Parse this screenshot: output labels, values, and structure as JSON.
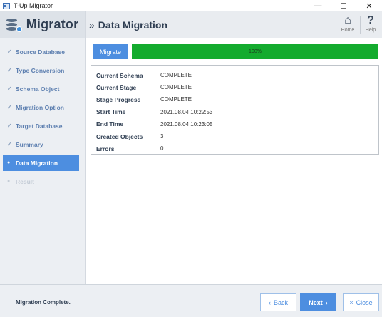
{
  "window": {
    "title": "T-Up Migrator",
    "minimize": "—",
    "maximize": "☐",
    "close": "✕"
  },
  "logo": {
    "text": "Migrator"
  },
  "sidebar": {
    "items": [
      {
        "label": "Source Database",
        "mark": "✓",
        "state": "done"
      },
      {
        "label": "Type Conversion",
        "mark": "✓",
        "state": "done"
      },
      {
        "label": "Schema Object",
        "mark": "✓",
        "state": "done"
      },
      {
        "label": "Migration Option",
        "mark": "✓",
        "state": "done"
      },
      {
        "label": "Target Database",
        "mark": "✓",
        "state": "done"
      },
      {
        "label": "Summary",
        "mark": "✓",
        "state": "done"
      },
      {
        "label": "Data Migration",
        "mark": "●",
        "state": "active"
      },
      {
        "label": "Result",
        "mark": "●",
        "state": "disabled"
      }
    ]
  },
  "header": {
    "arrow": "»",
    "title": "Data Migration",
    "home_label": "Home",
    "home_glyph": "⌂",
    "help_label": "Help",
    "help_glyph": "?"
  },
  "migration": {
    "button_label": "Migrate",
    "progress": 100,
    "progress_text": "100%"
  },
  "info": {
    "rows": [
      {
        "key": "Current Schema",
        "value": "COMPLETE"
      },
      {
        "key": "Current Stage",
        "value": "COMPLETE"
      },
      {
        "key": "Stage Progress",
        "value": "COMPLETE"
      },
      {
        "key": "Start Time",
        "value": "2021.08.04 10:22:53"
      },
      {
        "key": "End Time",
        "value": "2021.08.04 10:23:05"
      },
      {
        "key": "Created Objects",
        "value": "3"
      },
      {
        "key": "Errors",
        "value": "0"
      }
    ]
  },
  "footer": {
    "status": "Migration Complete.",
    "back_label": "Back",
    "back_icon": "‹",
    "next_label": "Next",
    "next_icon": "›",
    "close_label": "Close",
    "close_icon": "×"
  },
  "colors": {
    "accent": "#4d8ee0",
    "progress": "#14ab2e",
    "sidebar": "#eceff3",
    "text_dark": "#2f3e52"
  }
}
